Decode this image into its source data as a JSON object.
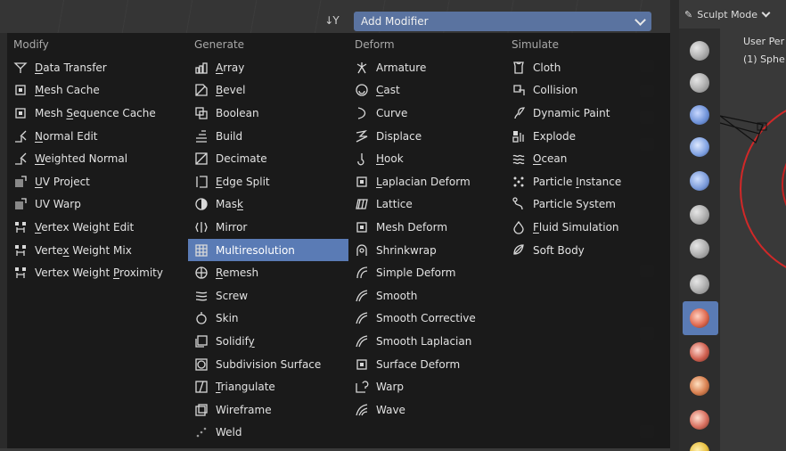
{
  "header": {
    "dropdown_label": "Add Modifier"
  },
  "columns": [
    {
      "id": "modify",
      "title": "Modify",
      "items": [
        {
          "pre": "",
          "u": "D",
          "post": "ata Transfer",
          "icon": "data-transfer-icon"
        },
        {
          "pre": "",
          "u": "M",
          "post": "esh Cache",
          "icon": "mesh-cache-icon"
        },
        {
          "pre": "Mesh ",
          "u": "S",
          "post": "equence Cache",
          "icon": "mesh-sequence-cache-icon"
        },
        {
          "pre": "",
          "u": "N",
          "post": "ormal Edit",
          "icon": "normal-edit-icon"
        },
        {
          "pre": "",
          "u": "W",
          "post": "eighted Normal",
          "icon": "weighted-normal-icon"
        },
        {
          "pre": "",
          "u": "U",
          "post": "V Project",
          "icon": "uv-project-icon"
        },
        {
          "pre": "UV Warp",
          "u": "",
          "post": "",
          "icon": "uv-warp-icon"
        },
        {
          "pre": "",
          "u": "V",
          "post": "ertex Weight Edit",
          "icon": "vertex-weight-edit-icon"
        },
        {
          "pre": "Verte",
          "u": "x",
          "post": " Weight Mix",
          "icon": "vertex-weight-mix-icon"
        },
        {
          "pre": "Vertex Weight ",
          "u": "P",
          "post": "roximity",
          "icon": "vertex-weight-proximity-icon"
        }
      ]
    },
    {
      "id": "generate",
      "title": "Generate",
      "items": [
        {
          "pre": "",
          "u": "A",
          "post": "rray",
          "icon": "array-icon"
        },
        {
          "pre": "",
          "u": "B",
          "post": "evel",
          "icon": "bevel-icon"
        },
        {
          "pre": "Boolean",
          "u": "",
          "post": "",
          "icon": "boolean-icon"
        },
        {
          "pre": "Build",
          "u": "",
          "post": "",
          "icon": "build-icon"
        },
        {
          "pre": "Decimate",
          "u": "",
          "post": "",
          "icon": "decimate-icon"
        },
        {
          "pre": "",
          "u": "E",
          "post": "dge Split",
          "icon": "edge-split-icon"
        },
        {
          "pre": "Mas",
          "u": "k",
          "post": "",
          "icon": "mask-icon"
        },
        {
          "pre": "Mirror",
          "u": "",
          "post": "",
          "icon": "mirror-icon"
        },
        {
          "pre": "Multiresolution",
          "u": "",
          "post": "",
          "icon": "multiresolution-icon",
          "active": true
        },
        {
          "pre": "",
          "u": "R",
          "post": "emesh",
          "icon": "remesh-icon"
        },
        {
          "pre": "Screw",
          "u": "",
          "post": "",
          "icon": "screw-icon"
        },
        {
          "pre": "Skin",
          "u": "",
          "post": "",
          "icon": "skin-icon"
        },
        {
          "pre": "Solidif",
          "u": "y",
          "post": "",
          "icon": "solidify-icon"
        },
        {
          "pre": "Subdivision Surface",
          "u": "",
          "post": "",
          "icon": "subdivision-surface-icon"
        },
        {
          "pre": "",
          "u": "T",
          "post": "riangulate",
          "icon": "triangulate-icon"
        },
        {
          "pre": "Wireframe",
          "u": "",
          "post": "",
          "icon": "wireframe-icon"
        },
        {
          "pre": "Weld",
          "u": "",
          "post": "",
          "icon": "weld-icon"
        }
      ]
    },
    {
      "id": "deform",
      "title": "Deform",
      "items": [
        {
          "pre": "Armature",
          "u": "",
          "post": "",
          "icon": "armature-icon"
        },
        {
          "pre": "",
          "u": "C",
          "post": "ast",
          "icon": "cast-icon"
        },
        {
          "pre": "Curve",
          "u": "",
          "post": "",
          "icon": "curve-icon"
        },
        {
          "pre": "Displace",
          "u": "",
          "post": "",
          "icon": "displace-icon"
        },
        {
          "pre": "",
          "u": "H",
          "post": "ook",
          "icon": "hook-icon"
        },
        {
          "pre": "",
          "u": "L",
          "post": "aplacian Deform",
          "icon": "laplacian-deform-icon"
        },
        {
          "pre": "Lattice",
          "u": "",
          "post": "",
          "icon": "lattice-icon"
        },
        {
          "pre": "Mesh Deform",
          "u": "",
          "post": "",
          "icon": "mesh-deform-icon"
        },
        {
          "pre": "Shrinkwrap",
          "u": "",
          "post": "",
          "icon": "shrinkwrap-icon"
        },
        {
          "pre": "Simple Deform",
          "u": "",
          "post": "",
          "icon": "simple-deform-icon"
        },
        {
          "pre": "Smooth",
          "u": "",
          "post": "",
          "icon": "smooth-icon"
        },
        {
          "pre": "Smooth Corrective",
          "u": "",
          "post": "",
          "icon": "smooth-corrective-icon"
        },
        {
          "pre": "Smooth Laplacian",
          "u": "",
          "post": "",
          "icon": "smooth-laplacian-icon"
        },
        {
          "pre": "Surface Deform",
          "u": "",
          "post": "",
          "icon": "surface-deform-icon"
        },
        {
          "pre": "Warp",
          "u": "",
          "post": "",
          "icon": "warp-icon"
        },
        {
          "pre": "Wave",
          "u": "",
          "post": "",
          "icon": "wave-icon"
        }
      ]
    },
    {
      "id": "simulate",
      "title": "Simulate",
      "items": [
        {
          "pre": "Cloth",
          "u": "",
          "post": "",
          "icon": "cloth-icon"
        },
        {
          "pre": "Collision",
          "u": "",
          "post": "",
          "icon": "collision-icon"
        },
        {
          "pre": "Dynamic Paint",
          "u": "",
          "post": "",
          "icon": "dynamic-paint-icon"
        },
        {
          "pre": "Explode",
          "u": "",
          "post": "",
          "icon": "explode-icon"
        },
        {
          "pre": "",
          "u": "O",
          "post": "cean",
          "icon": "ocean-icon"
        },
        {
          "pre": "Particle ",
          "u": "I",
          "post": "nstance",
          "icon": "particle-instance-icon"
        },
        {
          "pre": "Particle System",
          "u": "",
          "post": "",
          "icon": "particle-system-icon"
        },
        {
          "pre": "",
          "u": "F",
          "post": "luid Simulation",
          "icon": "fluid-simulation-icon"
        },
        {
          "pre": "Soft Body",
          "u": "",
          "post": "",
          "icon": "soft-body-icon"
        }
      ]
    }
  ],
  "sculpt": {
    "mode_label": "Sculpt Mode",
    "viewport_line1": "User Per",
    "viewport_line2": "(1) Sphe"
  }
}
